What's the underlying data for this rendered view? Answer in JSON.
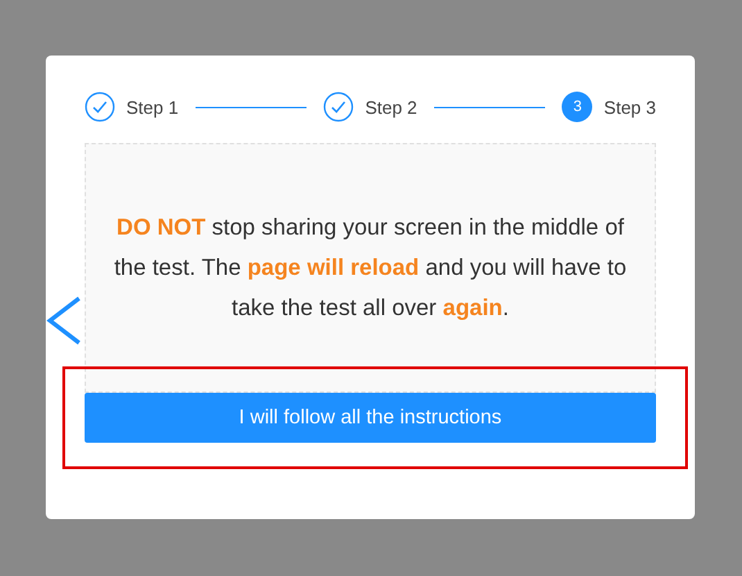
{
  "steps": [
    {
      "label": "Step 1",
      "completed": true
    },
    {
      "label": "Step 2",
      "completed": true
    },
    {
      "label": "Step 3",
      "completed": false,
      "number": "3"
    }
  ],
  "message": "**DO NOT** stop sharing your screen in the middle of the test. The **page will reload** and you will have to take the test all over **again**.",
  "button": {
    "label": "I will follow all the instructions",
    "highlighted": true
  }
}
